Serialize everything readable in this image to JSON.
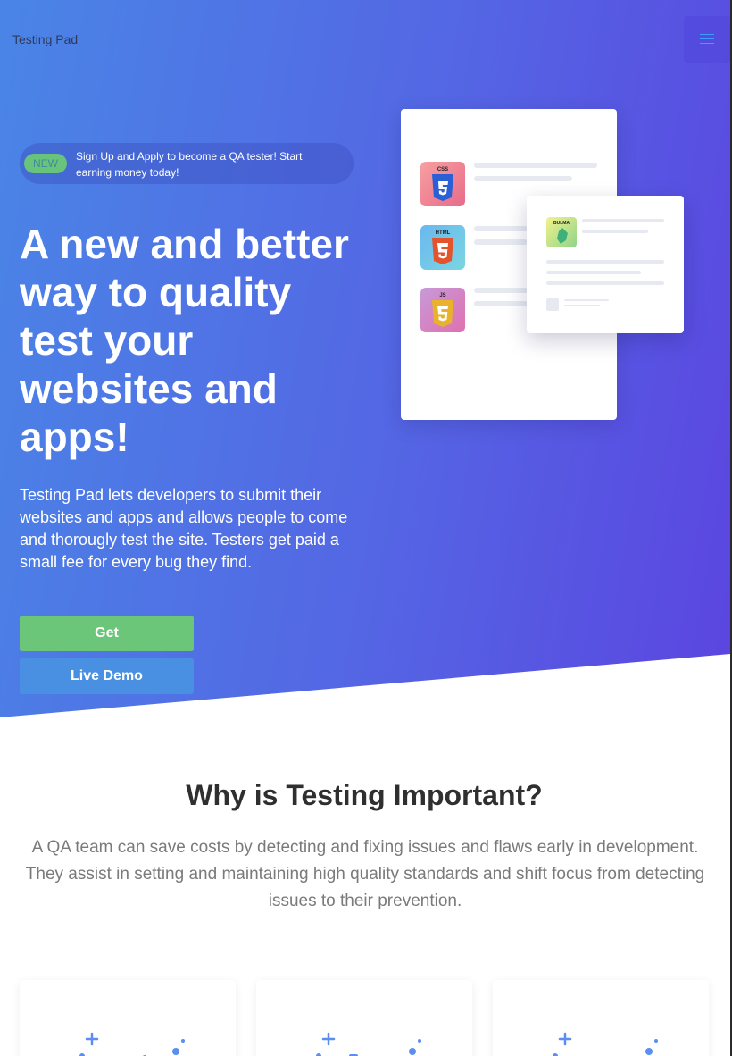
{
  "nav": {
    "brand": "Testing Pad",
    "menu_icon": "hamburger-icon"
  },
  "hero": {
    "announcement": {
      "badge": "NEW",
      "text": "Sign Up and Apply to become a QA tester! Start earning money today!"
    },
    "title": "A new and better way to quality test your websites and apps!",
    "description": "Testing Pad lets developers to submit their websites and apps and allows people to come and thorougly test the site. Testers get paid a small fee for every bug they find.",
    "buttons": {
      "get": "Get",
      "demo": "Live Demo"
    },
    "illustration": {
      "tech": [
        "CSS",
        "HTML",
        "JS"
      ],
      "floating_card_tag": "BULMA"
    }
  },
  "why": {
    "title": "Why is Testing Important?",
    "description": "A QA team can save costs by detecting and fixing issues and flaws early in development. They assist in setting and maintaining high quality standards and shift focus from detecting issues to their prevention."
  },
  "colors": {
    "gradient_start": "#4a85e6",
    "gradient_end": "#5b45e0",
    "get_button": "#6cc67a",
    "demo_button": "#4a90e2"
  }
}
